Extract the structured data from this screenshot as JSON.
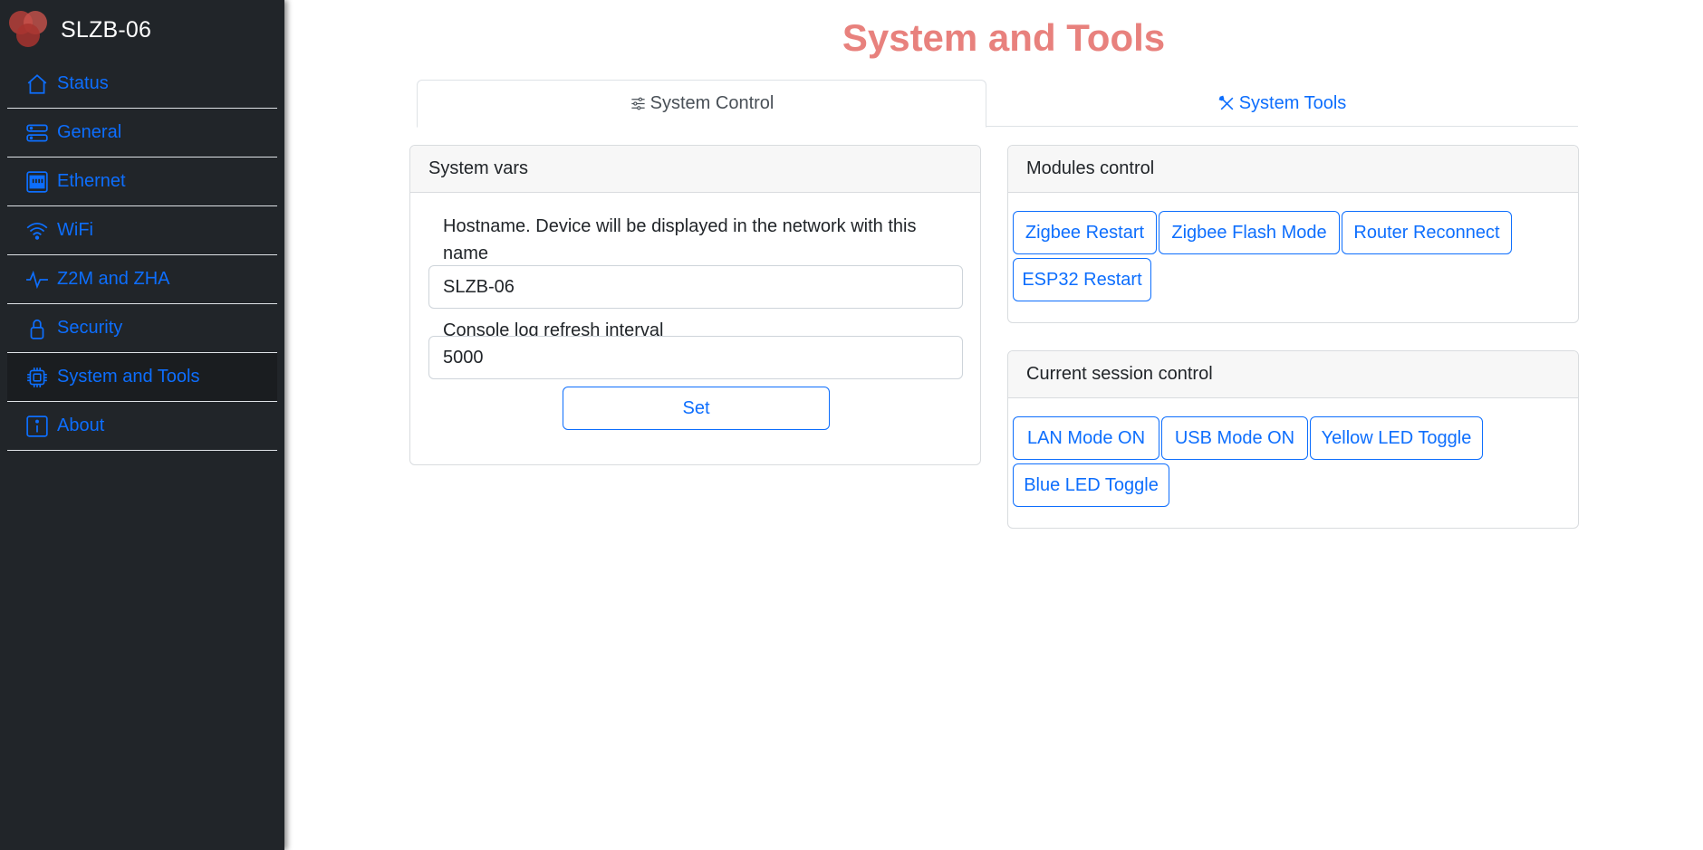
{
  "brand": {
    "title": "SLZB-06",
    "logo": "brand-logo"
  },
  "colors": {
    "accent": "#0d6efd",
    "title": "#e8817d",
    "sidebar_bg": "#212529"
  },
  "sidebar": {
    "items": [
      {
        "label": "Status",
        "icon": "house-icon"
      },
      {
        "label": "General",
        "icon": "server-icon"
      },
      {
        "label": "Ethernet",
        "icon": "ethernet-icon"
      },
      {
        "label": "WiFi",
        "icon": "wifi-icon"
      },
      {
        "label": "Z2M and ZHA",
        "icon": "activity-icon"
      },
      {
        "label": "Security",
        "icon": "lock-icon"
      },
      {
        "label": "System and Tools",
        "icon": "cpu-icon",
        "active": true
      },
      {
        "label": "About",
        "icon": "info-icon"
      }
    ]
  },
  "page": {
    "title": "System and Tools"
  },
  "tabs": [
    {
      "label": "System Control",
      "icon": "sliders-icon",
      "active": true
    },
    {
      "label": "System Tools",
      "icon": "tools-icon",
      "active": false
    }
  ],
  "system_vars": {
    "header": "System vars",
    "hostname_label": "Hostname. Device will be displayed in the network with this name",
    "hostname_value": "SLZB-06",
    "refresh_label": "Console log refresh interval",
    "refresh_value": "5000",
    "set_button": "Set"
  },
  "modules_control": {
    "header": "Modules control",
    "buttons": [
      "Zigbee Restart",
      "Zigbee Flash Mode",
      "Router Reconnect",
      "ESP32 Restart"
    ]
  },
  "session_control": {
    "header": "Current session control",
    "buttons": [
      "LAN Mode ON",
      "USB Mode ON",
      "Yellow LED Toggle",
      "Blue LED Toggle"
    ]
  }
}
